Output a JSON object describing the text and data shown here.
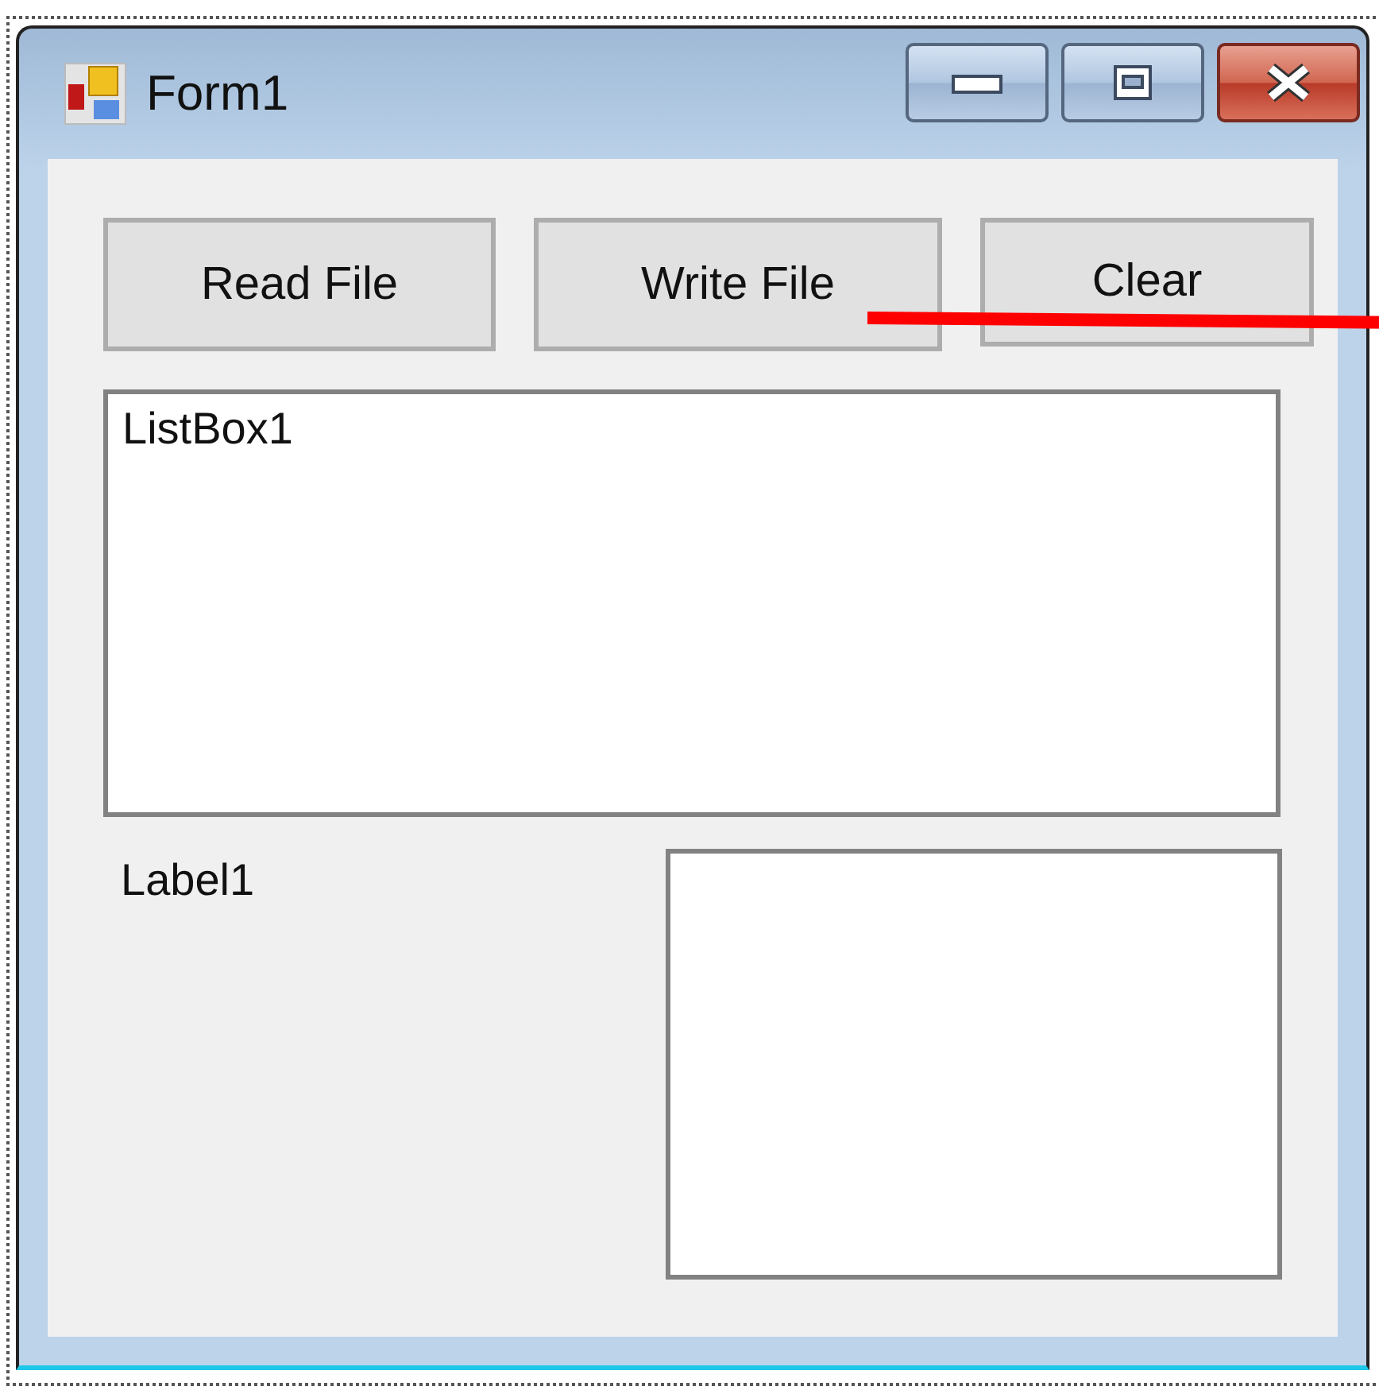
{
  "window": {
    "title": "Form1"
  },
  "buttons": [
    {
      "label": "Read File"
    },
    {
      "label": "Write File"
    },
    {
      "label": "Clear"
    }
  ],
  "listbox": {
    "text": "ListBox1"
  },
  "label": {
    "text": "Label1"
  }
}
